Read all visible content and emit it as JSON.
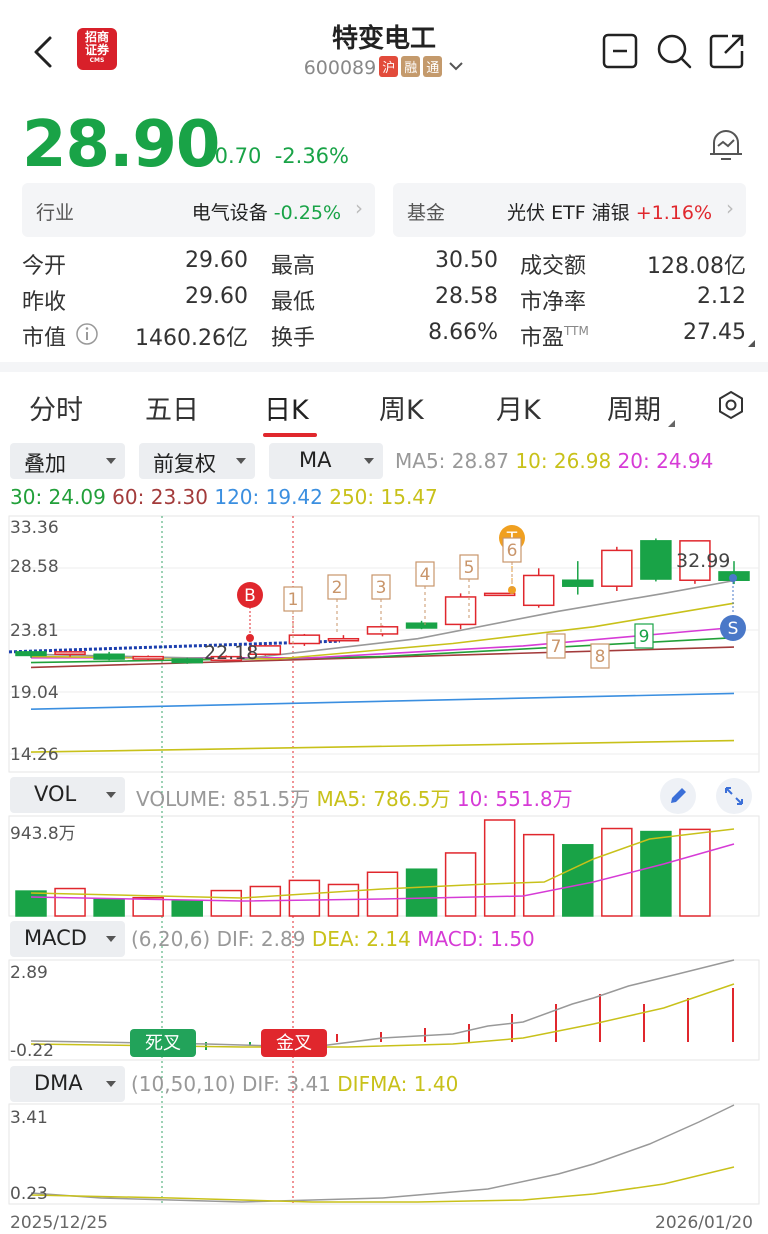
{
  "header": {
    "title": "特变电工",
    "code": "600089",
    "tags": [
      {
        "text": "沪",
        "color": "#e24b3b"
      },
      {
        "text": "融",
        "color": "#c49a6c"
      },
      {
        "text": "通",
        "color": "#c49a6c"
      }
    ],
    "logo_text_1": "招商",
    "logo_text_2": "证券",
    "logo_sub": "CMS"
  },
  "quote": {
    "price": "28.90",
    "change": "-0.70",
    "change_pct": "-2.36%"
  },
  "industry": {
    "label": "行业",
    "name": "电气设备",
    "pct": "-0.25%"
  },
  "fund": {
    "label": "基金",
    "name": "光伏 ETF 浦银",
    "pct": "+1.16%"
  },
  "stats": {
    "open_label": "今开",
    "open": "29.60",
    "high_label": "最高",
    "high": "30.50",
    "amount_label": "成交额",
    "amount": "128.08亿",
    "prev_label": "昨收",
    "prev": "29.60",
    "low_label": "最低",
    "low": "28.58",
    "pb_label": "市净率",
    "pb": "2.12",
    "mcap_label": "市值",
    "mcap": "1460.26亿",
    "turn_label": "换手",
    "turn": "8.66%",
    "pe_label": "市盈",
    "pe_sup": "TTM",
    "pe": "27.45"
  },
  "tabs": [
    "分时",
    "五日",
    "日K",
    "周K",
    "月K",
    "周期"
  ],
  "selectors": {
    "overlay": "叠加",
    "adjust": "前复权",
    "indicator": "MA"
  },
  "ma": {
    "ma5": "MA5: 28.87",
    "ma10": "10: 26.98",
    "ma20": "20: 24.94",
    "ma30": "30: 24.09",
    "ma60": "60: 23.30",
    "ma120": "120: 19.42",
    "ma250": "250: 15.47"
  },
  "price_axis": [
    "33.36",
    "28.58",
    "23.81",
    "19.04",
    "14.26"
  ],
  "chart_marks": {
    "high_label": "32.99",
    "low_label": "22.18",
    "b_mark": "B",
    "t_mark": "T",
    "s_mark": "S",
    "nums": [
      "1",
      "2",
      "3",
      "4",
      "5",
      "6",
      "7",
      "8",
      "9"
    ]
  },
  "vol": {
    "selector": "VOL",
    "volume": "VOLUME: 851.5万",
    "ma5": "MA5: 786.5万",
    "ma10": "10: 551.8万",
    "axis_top": "943.8万"
  },
  "macd": {
    "selector": "MACD",
    "params": "(6,20,6)",
    "dif": "DIF: 2.89",
    "dea": "DEA: 2.14",
    "macd": "MACD: 1.50",
    "axis_top": "2.89",
    "axis_bottom": "-0.22",
    "dead_cross": "死叉",
    "golden_cross": "金叉"
  },
  "dma": {
    "selector": "DMA",
    "params": "(10,50,10)",
    "dif": "DIF: 3.41",
    "difma": "DIFMA: 1.40",
    "axis_top": "3.41",
    "axis_bottom": "0.23"
  },
  "dates": {
    "start": "2025/12/25",
    "end": "2026/01/20"
  },
  "colors": {
    "up": "#e0272d",
    "down": "#19a347",
    "ma5": "#999999",
    "ma10": "#c8c11a",
    "ma20": "#d63bd6",
    "ma30": "#22a03a",
    "ma60": "#a33b3b",
    "ma120": "#3b8fe0",
    "ma250": "#c8c11a"
  },
  "chart_data": {
    "type": "candlestick",
    "dates": {
      "start": "2025/12/25",
      "end": "2026/01/20"
    },
    "candles": [
      {
        "o": 22.9,
        "c": 22.6,
        "h": 23.0,
        "l": 22.4
      },
      {
        "o": 22.7,
        "c": 22.9,
        "h": 23.0,
        "l": 22.5
      },
      {
        "o": 22.7,
        "c": 22.3,
        "h": 22.9,
        "l": 22.2
      },
      {
        "o": 22.3,
        "c": 22.5,
        "h": 22.6,
        "l": 22.2
      },
      {
        "o": 22.3,
        "c": 22.0,
        "h": 22.4,
        "l": 21.9
      },
      {
        "o": 22.2,
        "c": 22.5,
        "h": 22.6,
        "l": 22.18
      },
      {
        "o": 22.7,
        "c": 23.4,
        "h": 23.5,
        "l": 22.6
      },
      {
        "o": 23.6,
        "c": 24.3,
        "h": 24.4,
        "l": 23.4
      },
      {
        "o": 24.0,
        "c": 24.0,
        "h": 24.3,
        "l": 23.8
      },
      {
        "o": 24.4,
        "c": 25.0,
        "h": 25.1,
        "l": 24.2
      },
      {
        "o": 25.3,
        "c": 24.9,
        "h": 25.5,
        "l": 24.8
      },
      {
        "o": 25.2,
        "c": 27.5,
        "h": 27.8,
        "l": 24.8
      },
      {
        "o": 27.8,
        "c": 27.8,
        "h": 27.8,
        "l": 27.8
      },
      {
        "o": 26.8,
        "c": 29.3,
        "h": 29.9,
        "l": 26.6
      },
      {
        "o": 28.9,
        "c": 28.4,
        "h": 30.5,
        "l": 27.7
      },
      {
        "o": 28.4,
        "c": 31.4,
        "h": 31.7,
        "l": 28.0
      },
      {
        "o": 32.2,
        "c": 29.0,
        "h": 32.4,
        "l": 28.8
      },
      {
        "o": 28.9,
        "c": 32.2,
        "h": 32.2,
        "l": 28.6
      },
      {
        "o": 29.6,
        "c": 28.9,
        "h": 30.5,
        "l": 28.58
      }
    ],
    "volume": [
      245,
      270,
      165,
      180,
      145,
      250,
      290,
      350,
      310,
      430,
      460,
      620,
      943.8,
      800,
      700,
      860,
      830,
      851.5
    ],
    "axes": {
      "price": [
        14.26,
        33.36
      ],
      "volume_max": 943.8,
      "macd": [
        -0.22,
        2.89
      ],
      "dma": [
        0.23,
        3.41
      ]
    }
  }
}
